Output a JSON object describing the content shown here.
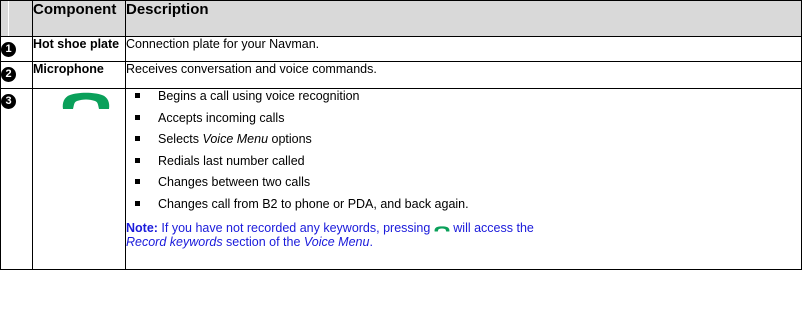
{
  "colors": {
    "header_bg": "#d9d9d9",
    "note_text": "#1a1adb",
    "phone_green": "#0aa05a"
  },
  "table": {
    "headers": {
      "number": "",
      "component": "Component",
      "description": "Description"
    },
    "rows": [
      {
        "number": "1",
        "component": "Hot shoe plate",
        "description": "Connection plate for your Navman."
      },
      {
        "number": "2",
        "component": "Microphone",
        "description": "Receives conversation and voice commands."
      },
      {
        "number": "3",
        "component_icon": "green-phone-handset-icon",
        "bullets": [
          {
            "text": "Begins a call using voice recognition"
          },
          {
            "text": "Accepts incoming calls"
          },
          {
            "pre": "Selects ",
            "em": "Voice Menu",
            "post": " options"
          },
          {
            "text": "Redials last number called"
          },
          {
            "text": "Changes between two calls"
          },
          {
            "text": "Changes call from B2 to phone or PDA, and back again."
          }
        ],
        "note": {
          "label": "Note:",
          "part1": " If you have not recorded any keywords, pressing ",
          "part2": " will access the",
          "em1": "Record keywords",
          "part3": " section of the ",
          "em2": "Voice Menu",
          "part4": "."
        }
      }
    ]
  }
}
